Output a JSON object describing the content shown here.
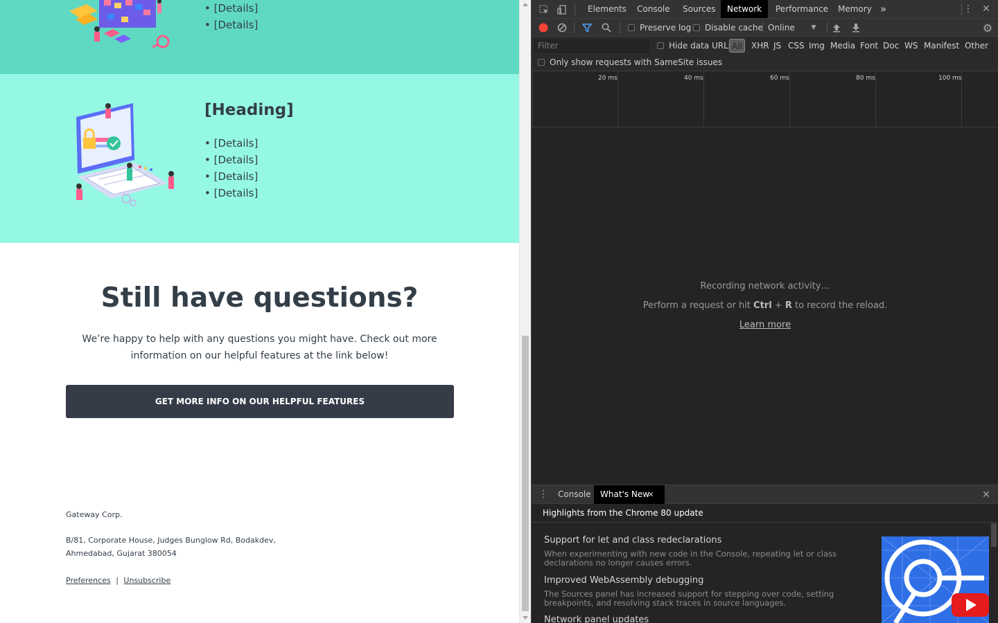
{
  "page": {
    "top_bullets": [
      "[Details]",
      "[Details]"
    ],
    "section2": {
      "heading": "[Heading]",
      "bullets": [
        "[Details]",
        "[Details]",
        "[Details]",
        "[Details]"
      ]
    },
    "questions": {
      "title": "Still have questions?",
      "text_line1": "We’re happy to help with any questions you might have. Check out more",
      "text_line2": "information on our helpful features at the link below!",
      "cta_label": "GET MORE INFO ON OUR HELPFUL FEATURES"
    },
    "footer": {
      "company": "Gateway Corp.",
      "address_line1": "B/81, Corporate House, Judges Bunglow Rd, Bodakdev,",
      "address_line2": "Ahmedabad, Gujarat 380054",
      "preferences": "Preferences",
      "separator": "|",
      "unsubscribe": "Unsubscribe"
    },
    "colors": {
      "band_dark": "#5fd9c1",
      "band_light": "#95f8e4",
      "text": "#333e48",
      "button": "#353b47"
    }
  },
  "devtools": {
    "tabs": [
      "Elements",
      "Console",
      "Sources",
      "Network",
      "Performance",
      "Memory"
    ],
    "active_tab": "Network",
    "more_tabs": "»",
    "toolbar": {
      "preserve_log": "Preserve log",
      "disable_cache": "Disable cache",
      "throttling": "Online"
    },
    "filter": {
      "placeholder": "Filter",
      "hide_data_urls": "Hide data URLs",
      "types": [
        "All",
        "XHR",
        "JS",
        "CSS",
        "Img",
        "Media",
        "Font",
        "Doc",
        "WS",
        "Manifest",
        "Other"
      ],
      "samesite": "Only show requests with SameSite issues"
    },
    "timeline_ticks": [
      "20 ms",
      "40 ms",
      "60 ms",
      "80 ms",
      "100 ms"
    ],
    "empty": {
      "line1": "Recording network activity…",
      "line2_pre": "Perform a request or hit ",
      "line2_ctrl": "Ctrl",
      "line2_plus": " + ",
      "line2_key": "R",
      "line2_post": " to record the reload.",
      "learn_more": "Learn more"
    },
    "drawer": {
      "tabs": [
        "Console",
        "What's New"
      ],
      "active_tab": "What's New",
      "header": "Highlights from the Chrome 80 update",
      "items": [
        {
          "title": "Support for let and class redeclarations",
          "desc": "When experimenting with new code in the Console, repeating let or class declarations no longer causes errors."
        },
        {
          "title": "Improved WebAssembly debugging",
          "desc": "The Sources panel has increased support for stepping over code, setting breakpoints, and resolving stack traces in source languages."
        },
        {
          "title": "Network panel updates",
          "desc": ""
        }
      ]
    }
  }
}
